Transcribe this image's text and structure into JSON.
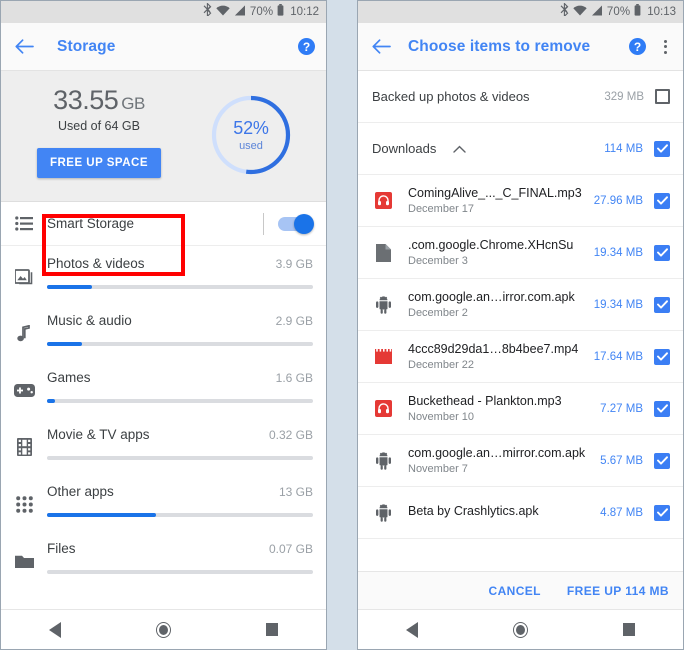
{
  "gap_color": "#d4dfe9",
  "accent_blue": "#4285f4",
  "highlight_red": "#ff0000",
  "left_phone": {
    "status_bar": {
      "bluetooth_icon": "bluetooth-icon",
      "wifi_icon": "wifi-icon",
      "signal_icon": "cell-signal-icon",
      "battery_percent": "70%",
      "battery_icon": "battery-icon",
      "time": "10:12"
    },
    "app_bar": {
      "back_icon": "back-arrow-icon",
      "title": "Storage",
      "help_label": "?"
    },
    "summary": {
      "used_value": "33.55",
      "used_unit": "GB",
      "used_of": "Used of 64 GB",
      "free_up_button": "FREE UP SPACE",
      "gauge_percent_label": "52%",
      "gauge_sub_label": "used",
      "gauge_percent_value": 52
    },
    "smart_storage": {
      "icon": "list-lines-icon",
      "label": "Smart Storage",
      "toggle_state": "on"
    },
    "categories": [
      {
        "icon": "photo-icon",
        "name": "Photos & videos",
        "size": "3.9 GB",
        "fill_percent": 17
      },
      {
        "icon": "music-note-icon",
        "name": "Music & audio",
        "size": "2.9 GB",
        "fill_percent": 13
      },
      {
        "icon": "gamepad-icon",
        "name": "Games",
        "size": "1.6 GB",
        "fill_percent": 3
      },
      {
        "icon": "film-icon",
        "name": "Movie & TV apps",
        "size": "0.32 GB",
        "fill_percent": 0
      },
      {
        "icon": "apps-grid-icon",
        "name": "Other apps",
        "size": "13 GB",
        "fill_percent": 41
      },
      {
        "icon": "folder-icon",
        "name": "Files",
        "size": "0.07 GB",
        "fill_percent": 0
      }
    ],
    "nav_bar": {
      "back": "nav-back-icon",
      "home": "nav-home-icon",
      "recents": "nav-recents-icon"
    }
  },
  "right_phone": {
    "status_bar": {
      "bluetooth_icon": "bluetooth-icon",
      "wifi_icon": "wifi-icon",
      "signal_icon": "cell-signal-icon",
      "battery_percent": "70%",
      "battery_icon": "battery-icon",
      "time": "10:13"
    },
    "app_bar": {
      "back_icon": "back-arrow-icon",
      "title": "Choose items to remove",
      "help_label": "?",
      "overflow_icon": "overflow-menu-icon"
    },
    "backed_up": {
      "name": "Backed up photos & videos",
      "size": "329 MB",
      "checked": false
    },
    "downloads_header": {
      "name": "Downloads",
      "caret_icon": "chevron-up-icon",
      "size": "114 MB",
      "checked": true
    },
    "files": [
      {
        "icon": "audio-file-icon",
        "name": "ComingAlive_..._C_FINAL.mp3",
        "date": "December 17",
        "size": "27.96 MB",
        "checked": true
      },
      {
        "icon": "generic-file-icon",
        "name": ".com.google.Chrome.XHcnSu",
        "date": "December 3",
        "size": "19.34 MB",
        "checked": true
      },
      {
        "icon": "android-apk-icon",
        "name": "com.google.an…irror.com.apk",
        "date": "December 2",
        "size": "19.34 MB",
        "checked": true
      },
      {
        "icon": "video-file-icon",
        "name": "4ccc89d29da1…8b4bee7.mp4",
        "date": "December 22",
        "size": "17.64 MB",
        "checked": true
      },
      {
        "icon": "audio-file-icon",
        "name": "Buckethead - Plankton.mp3",
        "date": "November 10",
        "size": "7.27 MB",
        "checked": true
      },
      {
        "icon": "android-apk-icon",
        "name": "com.google.an…mirror.com.apk",
        "date": "November 7",
        "size": "5.67 MB",
        "checked": true
      },
      {
        "icon": "android-apk-icon",
        "name": "Beta by Crashlytics.apk",
        "date": "",
        "size": "4.87 MB",
        "checked": true
      }
    ],
    "action_bar": {
      "cancel_label": "CANCEL",
      "free_up_label": "FREE UP 114 MB"
    },
    "nav_bar": {
      "back": "nav-back-icon",
      "home": "nav-home-icon",
      "recents": "nav-recents-icon"
    }
  }
}
